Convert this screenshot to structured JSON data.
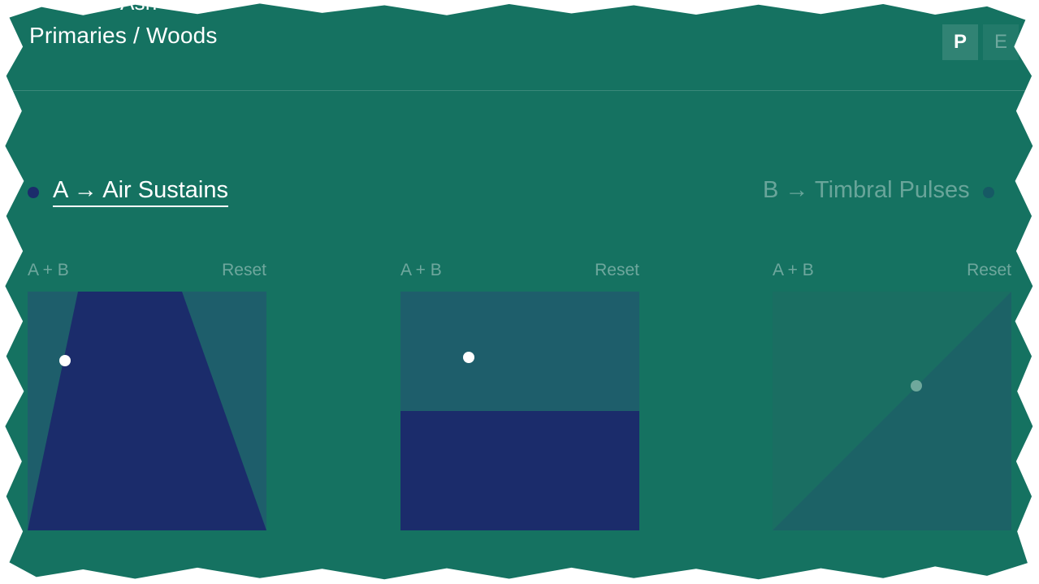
{
  "header": {
    "crumb_top": "Ash",
    "crumb": "Primaries / Woods",
    "corner_button_1": "P",
    "corner_button_2": "E"
  },
  "modes": {
    "a_label": "A → Air Sustains",
    "b_label": "B → Timbral Pulses",
    "active": "A"
  },
  "pads": [
    {
      "label": "A + B",
      "reset": "Reset",
      "shape": "trapezoid",
      "active": true
    },
    {
      "label": "A + B",
      "reset": "Reset",
      "shape": "half",
      "active": true
    },
    {
      "label": "A + B",
      "reset": "Reset",
      "shape": "diagonal",
      "active": false
    }
  ],
  "colors": {
    "background": "#157261",
    "pad_base": "#1e5e6b",
    "pad_fill": "#1b2c6b",
    "thumb": "#ffffff"
  }
}
